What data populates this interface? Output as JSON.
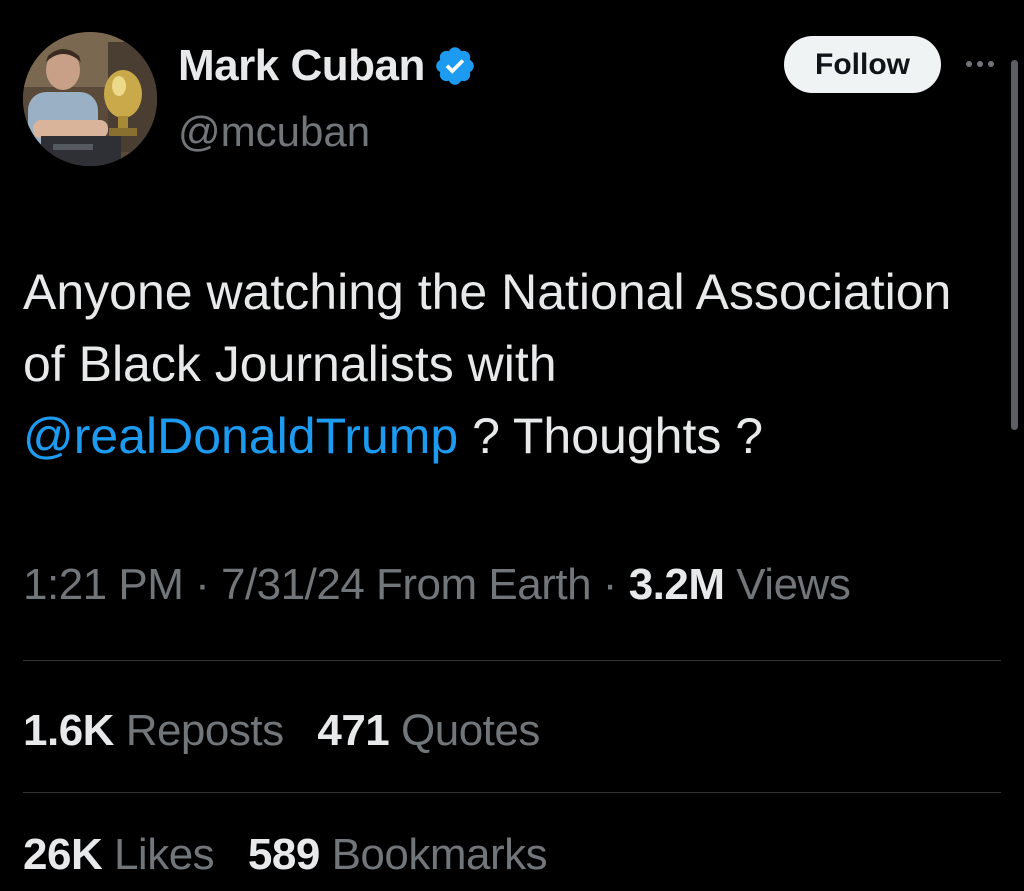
{
  "author": {
    "display_name": "Mark Cuban",
    "handle": "@mcuban",
    "verified": true,
    "avatar_icon": "profile-photo"
  },
  "actions": {
    "follow_label": "Follow",
    "more_icon": "ellipsis-icon"
  },
  "tweet": {
    "text_before": "Anyone watching the National Association of Black Journalists with ",
    "mention": "@realDonaldTrump",
    "text_after": " ? Thoughts ?"
  },
  "meta": {
    "time": "1:21 PM",
    "separator1": " · ",
    "date": "7/31/24",
    "source": " From Earth",
    "separator2": " · ",
    "views_count": "3.2M",
    "views_label": " Views"
  },
  "stats_row1": [
    {
      "count": "1.6K",
      "label": "Reposts"
    },
    {
      "count": "471",
      "label": "Quotes"
    }
  ],
  "stats_row2": [
    {
      "count": "26K",
      "label": "Likes"
    },
    {
      "count": "589",
      "label": "Bookmarks"
    }
  ],
  "colors": {
    "background": "#000000",
    "text": "#e7e9ea",
    "secondary": "#71767b",
    "accent": "#1d9bf0",
    "divider": "#2f3336"
  }
}
